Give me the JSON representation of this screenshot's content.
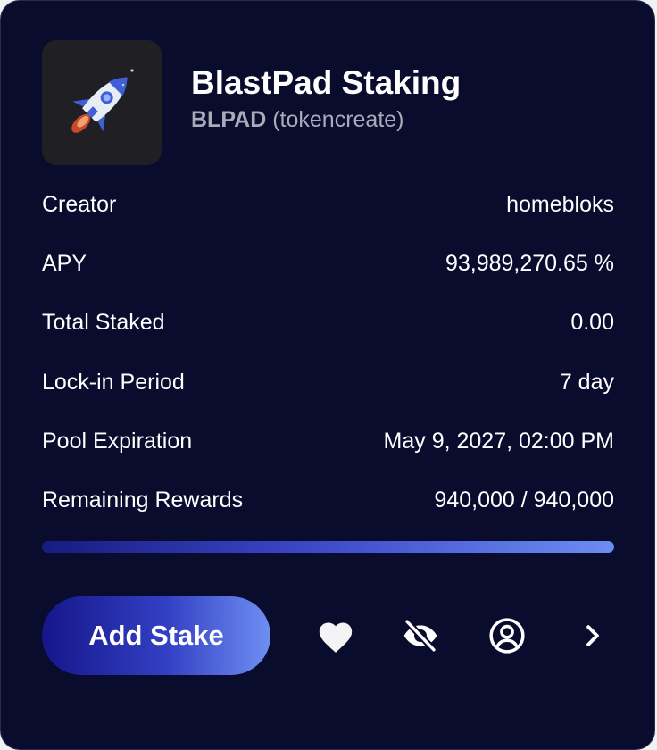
{
  "pool": {
    "name": "BlastPad Staking",
    "ticker": "BLPAD",
    "source": "(tokencreate)",
    "logo_icon": "rocket-icon"
  },
  "details": [
    {
      "label": "Creator",
      "value": "homebloks"
    },
    {
      "label": "APY",
      "value": "93,989,270.65 %"
    },
    {
      "label": "Total Staked",
      "value": "0.00"
    },
    {
      "label": "Lock-in Period",
      "value": "7 day"
    },
    {
      "label": "Pool Expiration",
      "value": "May 9, 2027, 02:00 PM"
    },
    {
      "label": "Remaining Rewards",
      "value": "940,000 / 940,000"
    }
  ],
  "rewards_progress": {
    "remaining_fraction": 1.0
  },
  "actions": {
    "add_stake_label": "Add Stake",
    "icons": [
      "heart-icon",
      "eye-off-icon",
      "user-circle-icon",
      "chevron-right-icon"
    ]
  },
  "colors": {
    "card_background": "#0a0c2e",
    "text_primary": "#ffffff",
    "text_secondary": "#a9abb8",
    "accent_start": "#15168a",
    "accent_end": "#6f8ff2"
  }
}
